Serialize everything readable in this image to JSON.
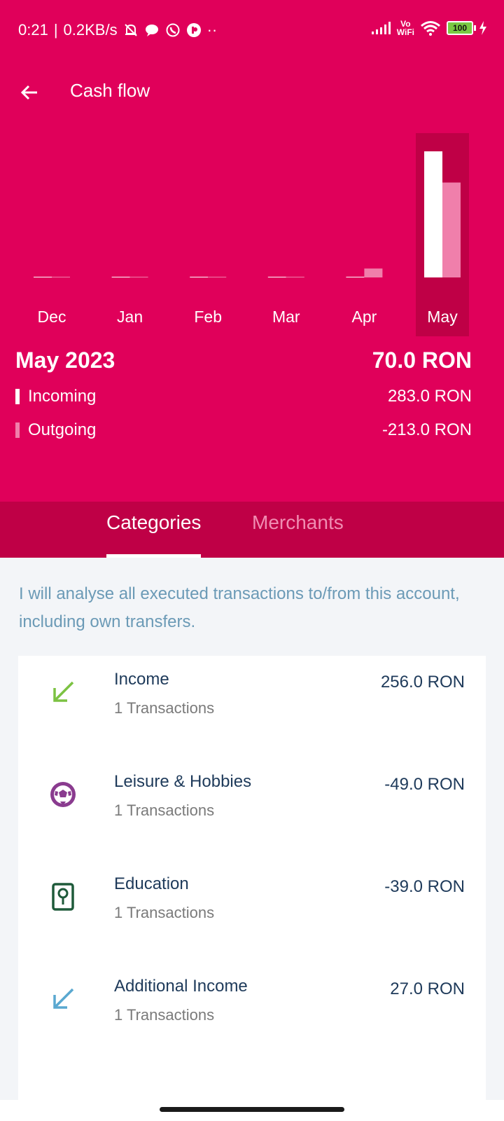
{
  "status_bar": {
    "time": "0:21",
    "speed": "0.2KB/s",
    "vowifi_top": "Vo",
    "vowifi_bottom": "WiFi",
    "battery": "100"
  },
  "header": {
    "title": "Cash flow"
  },
  "chart_data": {
    "type": "bar",
    "categories": [
      "Dec",
      "Jan",
      "Feb",
      "Mar",
      "Apr",
      "May"
    ],
    "series": [
      {
        "name": "Incoming",
        "values": [
          0,
          0,
          0,
          0,
          0,
          283.0
        ],
        "color": "#ffffff"
      },
      {
        "name": "Outgoing",
        "values": [
          0,
          0,
          0,
          0,
          20,
          213.0
        ],
        "color": "#f07fab"
      }
    ],
    "selected": "May"
  },
  "summary": {
    "period": "May 2023",
    "net": "70.0 RON",
    "incoming_label": "Incoming",
    "incoming_amount": "283.0 RON",
    "outgoing_label": "Outgoing",
    "outgoing_amount": "-213.0 RON"
  },
  "tabs": [
    {
      "label": "Categories",
      "active": true
    },
    {
      "label": "Merchants",
      "active": false
    }
  ],
  "description": "I will analyse all executed transactions to/from this account, including own transfers.",
  "categories": [
    {
      "name": "Income",
      "count": "1 Transactions",
      "amount": "256.0 RON",
      "icon": "arrow-down-left-icon",
      "color": "#7cc242"
    },
    {
      "name": "Leisure & Hobbies",
      "count": "1 Transactions",
      "amount": "-49.0 RON",
      "icon": "soccer-ball-icon",
      "color": "#8a3b8f"
    },
    {
      "name": "Education",
      "count": "1 Transactions",
      "amount": "-39.0 RON",
      "icon": "certificate-icon",
      "color": "#1e5a3a"
    },
    {
      "name": "Additional Income",
      "count": "1 Transactions",
      "amount": "27.0 RON",
      "icon": "arrow-down-left-icon",
      "color": "#5aa8d0"
    }
  ],
  "colors": {
    "primary": "#e0005a",
    "primary_dark": "#bf0046",
    "outgoing": "#f07fab",
    "text_dark": "#1e3a5a",
    "desc_text": "#6b9ab6"
  }
}
